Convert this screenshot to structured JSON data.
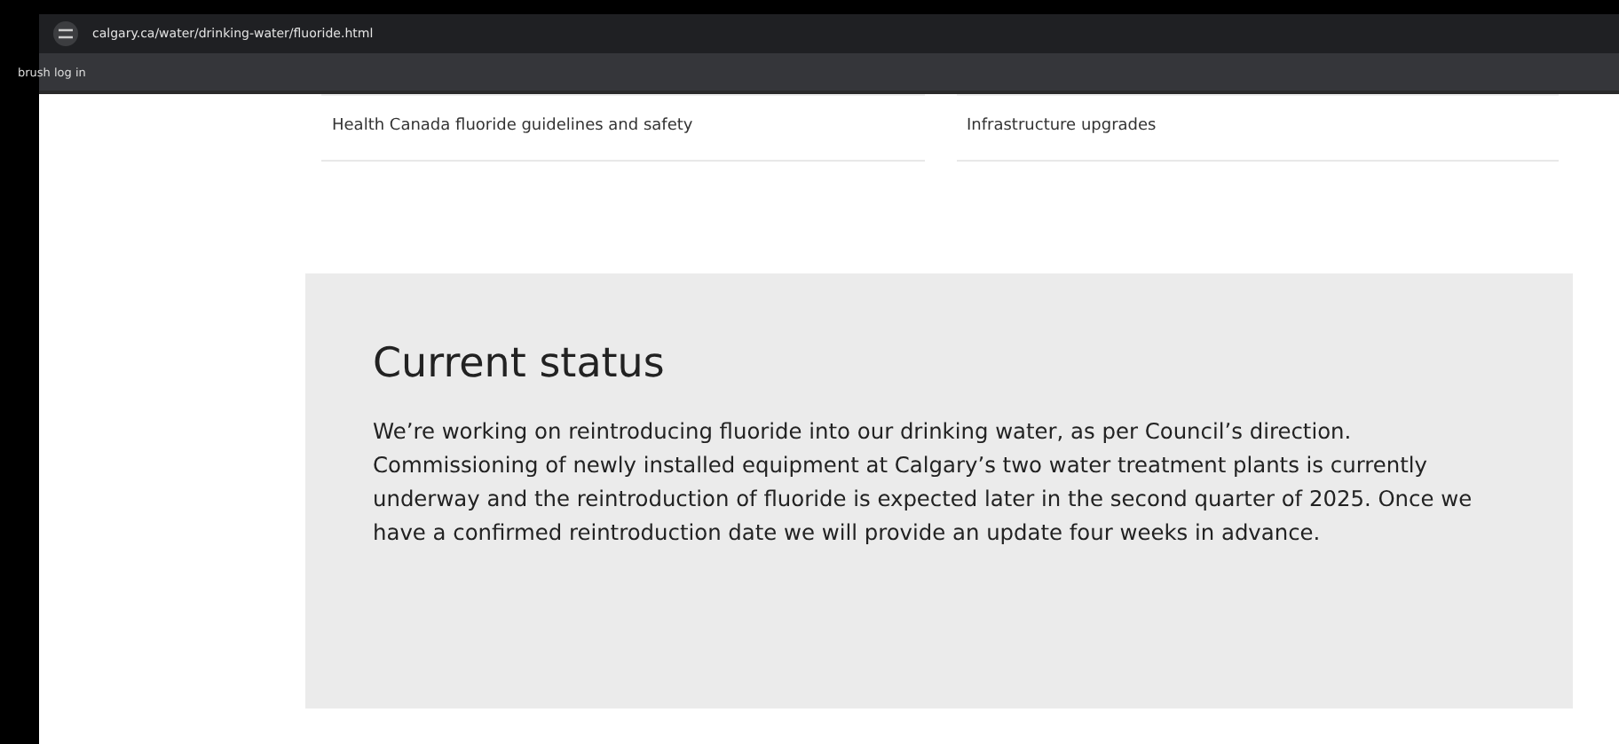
{
  "browser": {
    "url": "calgary.ca/water/drinking-water/fluoride.html",
    "bookmarks": [
      "brush log in"
    ]
  },
  "links": [
    {
      "label": "Health Canada fluoride guidelines and safety"
    },
    {
      "label": "Infrastructure upgrades"
    }
  ],
  "status": {
    "heading": "Current status",
    "body": "We’re working on reintroducing fluoride into our drinking water, as per Council’s direction. Commissioning of newly installed equipment at Calgary’s two water treatment plants is currently underway and the reintroduction of fluoride is expected later in the second quarter of 2025. Once we have a confirmed reintroduction date we will provide an update four weeks in advance."
  }
}
